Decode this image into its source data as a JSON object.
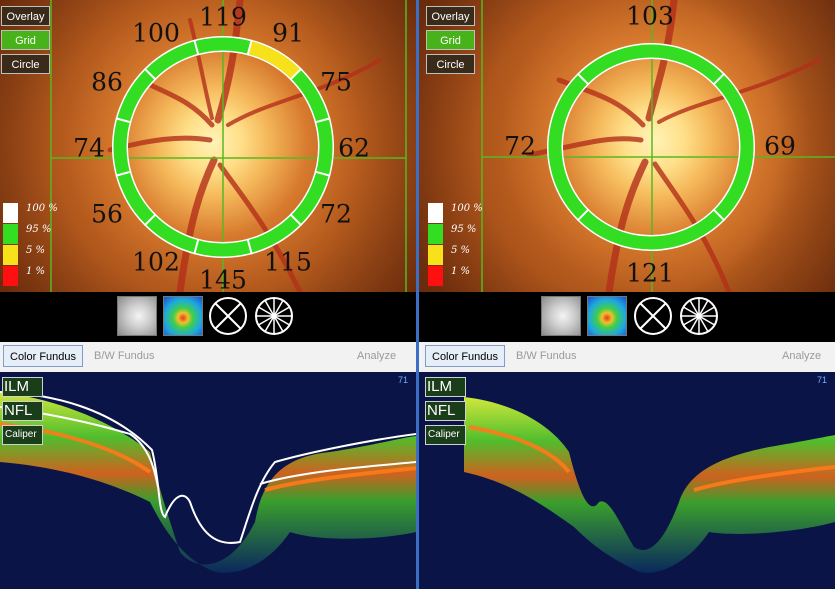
{
  "overlay_buttons": [
    "Overlay",
    "Grid",
    "Circle"
  ],
  "scale_labels": [
    "100 %",
    "95 %",
    "5 %",
    "1 %"
  ],
  "colors": {
    "normal": "#33dd22",
    "borderline": "#f7e11a",
    "outside": "#ff1010",
    "within": "#ffffff",
    "grid": "#58b820"
  },
  "icons": [
    "bw-fundus-thumbnail",
    "thickness-map-thumbnail",
    "quadrant-circle-icon",
    "clock-hour-circle-icon"
  ],
  "tabs": {
    "color_fundus": "Color Fundus",
    "bw_fundus": "B/W Fundus",
    "analyze": "Analyze"
  },
  "oct_buttons": [
    "ILM",
    "NFL",
    "Caliper"
  ],
  "scan_number": "71",
  "left_eye": {
    "clock_values": {
      "top": "119",
      "top_left_upper": "100",
      "top_right_upper": "91",
      "left_upper": "86",
      "right_upper": "75",
      "left": "74",
      "right": "62",
      "left_lower": "56",
      "right_lower": "72",
      "bottom_left": "102",
      "bottom": "145",
      "bottom_right": "115"
    },
    "borderline_sector": "91"
  },
  "right_eye": {
    "quadrant_values": {
      "top": "103",
      "left": "72",
      "right": "69",
      "bottom": "121"
    }
  }
}
